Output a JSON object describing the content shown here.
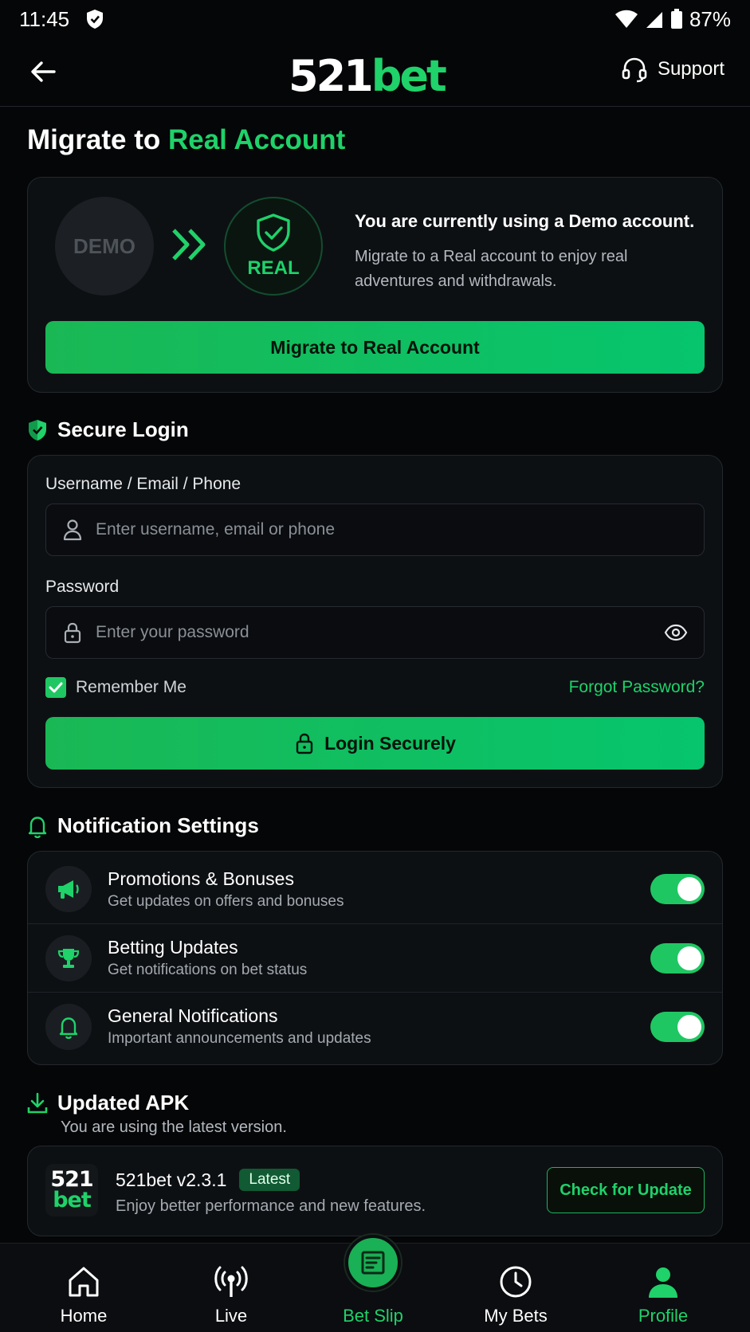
{
  "status_bar": {
    "time": "11:45",
    "battery": "87%"
  },
  "header": {
    "logo_num": "521",
    "logo_word": "bet",
    "support_label": "Support"
  },
  "page": {
    "title_prefix": "Migrate to",
    "title_highlight": "Real Account"
  },
  "migrate_card": {
    "demo_label": "DEMO",
    "real_label": "REAL",
    "heading": "You are currently using a Demo account.",
    "description": "Migrate to a Real account to enjoy real adventures and withdrawals.",
    "button_label": "Migrate to Real Account"
  },
  "secure_login": {
    "title": "Secure Login",
    "username_label": "Username / Email / Phone",
    "username_placeholder": "Enter username, email or phone",
    "username_value": "",
    "password_label": "Password",
    "password_placeholder": "Enter your password",
    "password_value": "",
    "remember_label": "Remember Me",
    "remember_checked": true,
    "forgot_label": "Forgot Password?",
    "login_button": "Login Securely"
  },
  "notifications": {
    "title": "Notification Settings",
    "items": [
      {
        "title": "Promotions & Bonuses",
        "subtitle": "Get updates on offers and bonuses",
        "icon": "megaphone-icon",
        "enabled": true
      },
      {
        "title": "Betting Updates",
        "subtitle": "Get notifications on bet status",
        "icon": "trophy-icon",
        "enabled": true
      },
      {
        "title": "General Notifications",
        "subtitle": "Important announcements and updates",
        "icon": "bell-icon",
        "enabled": true
      }
    ]
  },
  "apk": {
    "title": "Updated APK",
    "subtitle": "You are using the latest version.",
    "logo_num": "521",
    "logo_word": "bet",
    "version": "521bet v2.3.1",
    "badge": "Latest",
    "description": "Enjoy better performance and new features.",
    "button": "Check for Update"
  },
  "bottom_nav": {
    "items": [
      {
        "label": "Home",
        "icon": "home-icon"
      },
      {
        "label": "Live",
        "icon": "broadcast-icon"
      },
      {
        "label": "Bet Slip",
        "icon": "bet-slip-icon"
      },
      {
        "label": "My Bets",
        "icon": "clock-icon"
      },
      {
        "label": "Profile",
        "icon": "user-icon"
      }
    ],
    "active": "Profile"
  },
  "colors": {
    "accent": "#1fd26a",
    "background": "#050607",
    "card": "#0d1013"
  }
}
